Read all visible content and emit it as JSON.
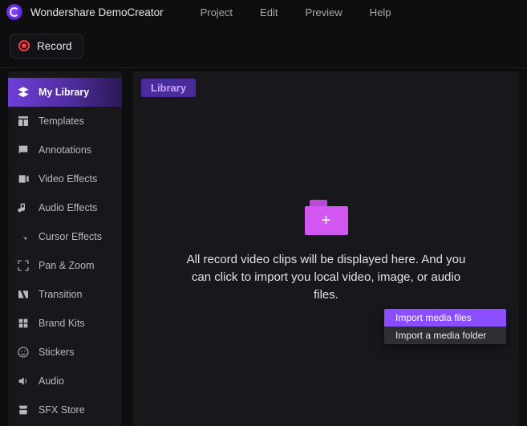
{
  "app": {
    "title": "Wondershare DemoCreator"
  },
  "menubar": {
    "items": [
      {
        "label": "Project"
      },
      {
        "label": "Edit"
      },
      {
        "label": "Preview"
      },
      {
        "label": "Help"
      }
    ]
  },
  "toolbar": {
    "record_label": "Record"
  },
  "sidebar": {
    "items": [
      {
        "label": "My Library",
        "icon": "layers-icon",
        "active": true
      },
      {
        "label": "Templates",
        "icon": "templates-icon",
        "active": false
      },
      {
        "label": "Annotations",
        "icon": "annotations-icon",
        "active": false
      },
      {
        "label": "Video Effects",
        "icon": "video-fx-icon",
        "active": false
      },
      {
        "label": "Audio Effects",
        "icon": "audio-fx-icon",
        "active": false
      },
      {
        "label": "Cursor Effects",
        "icon": "cursor-fx-icon",
        "active": false
      },
      {
        "label": "Pan & Zoom",
        "icon": "pan-zoom-icon",
        "active": false
      },
      {
        "label": "Transition",
        "icon": "transition-icon",
        "active": false
      },
      {
        "label": "Brand Kits",
        "icon": "brand-kits-icon",
        "active": false
      },
      {
        "label": "Stickers",
        "icon": "stickers-icon",
        "active": false
      },
      {
        "label": "Audio",
        "icon": "audio-icon",
        "active": false
      },
      {
        "label": "SFX Store",
        "icon": "sfx-store-icon",
        "active": false
      }
    ]
  },
  "main": {
    "chip_label": "Library",
    "empty_text": "All record video clips will be displayed here. And you can click to import you local video, image, or audio files.",
    "import_menu": {
      "item_files": "Import media files",
      "item_folder": "Import a media folder"
    }
  }
}
